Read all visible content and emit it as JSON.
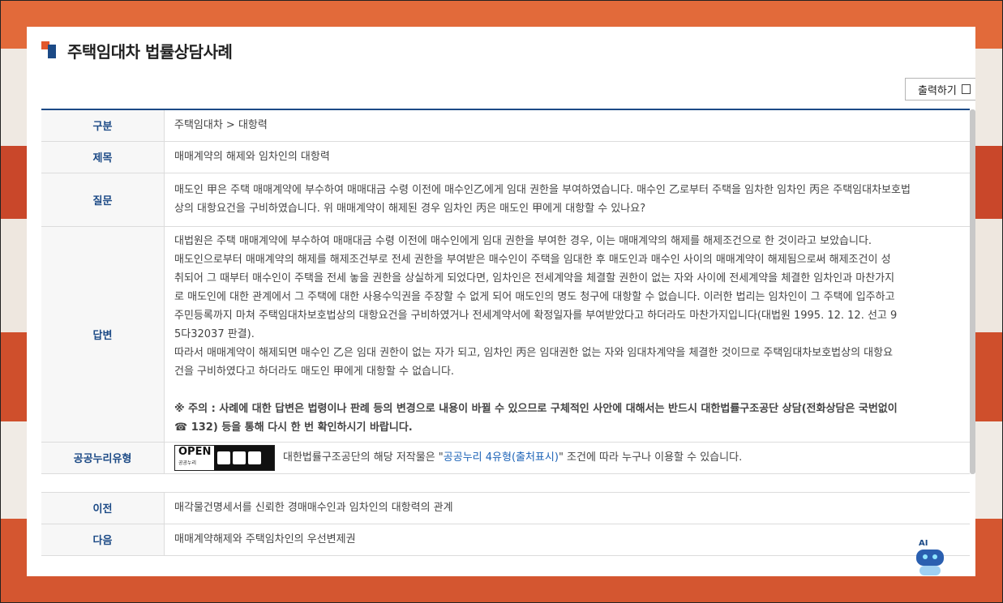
{
  "page": {
    "title": "주택임대차 법률상담사례"
  },
  "toolbar": {
    "print_label": "출력하기"
  },
  "table": {
    "category": {
      "label": "구분",
      "value": "주택임대차 > 대항력"
    },
    "subject": {
      "label": "제목",
      "value": "매매계약의 해제와 임차인의 대항력"
    },
    "question": {
      "label": "질문",
      "lines": [
        "매도인 甲은 주택 매매계약에 부수하여 매매대금 수령 이전에 매수인乙에게 임대 권한을 부여하였습니다. 매수인 乙로부터 주택을 임차한 임차인 丙은 주택임대차보호법",
        "상의 대항요건을 구비하였습니다. 위 매매계약이 해제된 경우 임차인 丙은 매도인 甲에게 대항할 수 있나요?"
      ]
    },
    "answer": {
      "label": "답변",
      "lines": [
        "대법원은 주택 매매계약에 부수하여 매매대금 수령 이전에 매수인에게 임대 권한을 부여한 경우, 이는 매매계약의 해제를 해제조건으로 한 것이라고 보았습니다.",
        "매도인으로부터 매매계약의 해제를 해제조건부로 전세 권한을 부여받은 매수인이 주택을 임대한 후 매도인과 매수인 사이의 매매계약이 해제됨으로써 해제조건이 성",
        "취되어 그 때부터 매수인이 주택을 전세 놓을 권한을 상실하게 되었다면, 임차인은 전세계약을 체결할 권한이 없는 자와 사이에 전세계약을 체결한 임차인과 마찬가지",
        "로 매도인에 대한 관계에서 그 주택에 대한 사용수익권을 주장할 수 없게 되어 매도인의 명도 청구에 대항할 수 없습니다. 이러한 법리는 임차인이 그 주택에 입주하고",
        "주민등록까지 마쳐 주택임대차보호법상의 대항요건을 구비하였거나 전세계약서에 확정일자를 부여받았다고 하더라도 마찬가지입니다(대법원 1995. 12. 12. 선고 9",
        "5다32037 판결).",
        "따라서 매매계약이 해제되면 매수인 乙은 임대 권한이 없는 자가 되고, 임차인 丙은 임대권한 없는 자와 임대차계약을 체결한 것이므로 주택임대차보호법상의 대항요",
        "건을 구비하였다고 하더라도 매도인 甲에게 대항할 수 없습니다."
      ],
      "note_lines": [
        "※ 주의 : 사례에 대한 답변은 법령이나 판례 등의 변경으로 내용이 바뀔 수 있으므로 구체적인 사안에 대해서는 반드시 대한법률구조공단 상담(전화상담은 국번없이",
        "☎ 132) 등을 통해 다시 한 번 확인하시기 바랍니다."
      ]
    },
    "license": {
      "label": "공공누리유형",
      "badge_text": "OPEN",
      "badge_sub": "공공누리",
      "text_before": "대한법률구조공단의 해당 저작물은 \"",
      "link_text": "공공누리 4유형(출처표시)",
      "text_after": "\" 조건에 따라 누구나 이용할 수 있습니다."
    },
    "prev": {
      "label": "이전",
      "value": "매각물건명세서를 신뢰한 경매매수인과 임차인의 대항력의 관계"
    },
    "next": {
      "label": "다음",
      "value": "매매계약해제와 주택임차인의 우선변제권"
    }
  },
  "assistant": {
    "label": "AI"
  },
  "colors": {
    "accent_blue": "#1c4a86",
    "accent_orange": "#e2572b",
    "link": "#1c63b7"
  }
}
